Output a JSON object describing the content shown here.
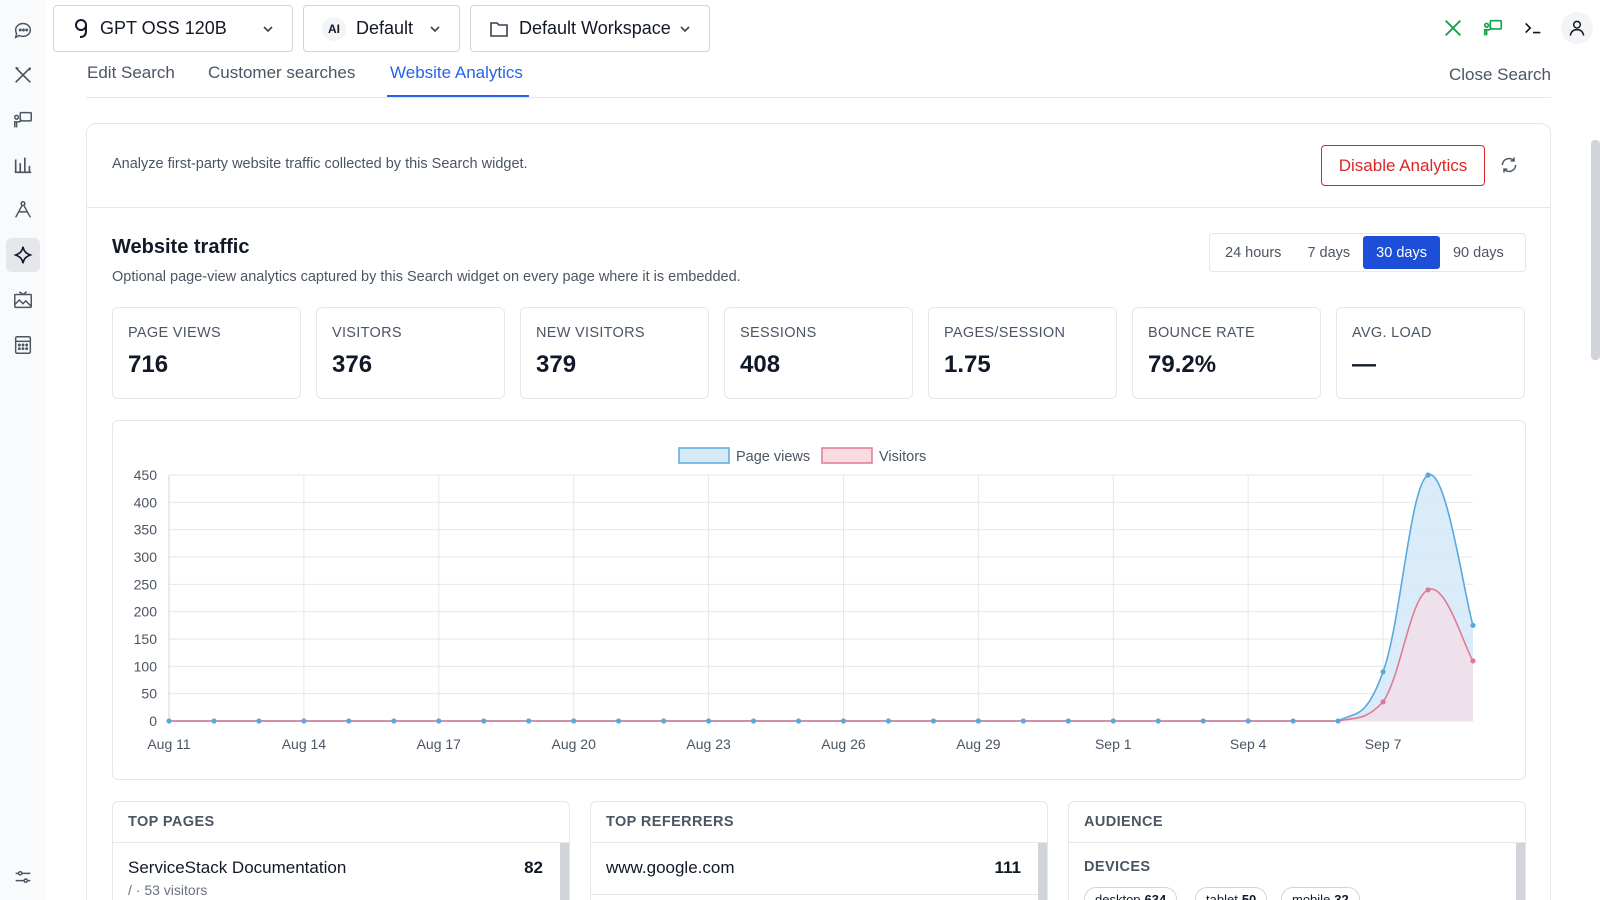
{
  "top_bar": {
    "model": {
      "icon": "qwen-logo-icon",
      "label": "GPT OSS 120B"
    },
    "persona": {
      "icon": "ai-icon",
      "icon_text": "AI",
      "label": "Default"
    },
    "workspace": {
      "icon": "folder-icon",
      "label": "Default Workspace"
    },
    "right_icons": [
      "tools-icon",
      "presenter-icon",
      "terminal-icon",
      "user-icon"
    ]
  },
  "sidebar": {
    "items": [
      "chat-icon",
      "tools-icon",
      "presenter-icon",
      "bar-chart-icon",
      "compass-icon",
      "sparkle-icon",
      "image-icon",
      "calculator-icon",
      "settings-sliders-icon"
    ],
    "active": "sparkle-icon"
  },
  "tabs": {
    "items": [
      {
        "label": "Edit Search"
      },
      {
        "label": "Customer searches"
      },
      {
        "label": "Website Analytics"
      }
    ],
    "active": "Website Analytics",
    "close_label": "Close Search"
  },
  "analytics": {
    "description": "Analyze first-party website traffic collected by this Search widget.",
    "disable_label": "Disable Analytics",
    "refresh_icon": "refresh-icon",
    "traffic_title": "Website traffic",
    "traffic_subtitle": "Optional page-view analytics captured by this Search widget on every page where it is embedded.",
    "ranges": [
      "24 hours",
      "7 days",
      "30 days",
      "90 days"
    ],
    "active_range": "30 days",
    "stats": [
      {
        "label": "PAGE VIEWS",
        "value": "716"
      },
      {
        "label": "VISITORS",
        "value": "376"
      },
      {
        "label": "NEW VISITORS",
        "value": "379"
      },
      {
        "label": "SESSIONS",
        "value": "408"
      },
      {
        "label": "PAGES/SESSION",
        "value": "1.75"
      },
      {
        "label": "BOUNCE RATE",
        "value": "79.2%"
      },
      {
        "label": "AVG. LOAD",
        "value": "—"
      }
    ]
  },
  "panels": {
    "top_pages": {
      "title": "TOP PAGES",
      "rows": [
        {
          "label": "ServiceStack Documentation",
          "sub": "/ · 53 visitors",
          "count": "82"
        }
      ]
    },
    "top_referrers": {
      "title": "TOP REFERRERS",
      "rows": [
        {
          "label": "www.google.com",
          "count": "111"
        }
      ]
    },
    "audience": {
      "title": "AUDIENCE",
      "devices_title": "DEVICES",
      "devices": [
        {
          "name": "desktop",
          "count": "634"
        },
        {
          "name": "tablet",
          "count": "50"
        },
        {
          "name": "mobile",
          "count": "32"
        }
      ]
    }
  },
  "colors": {
    "accent": "#2563eb",
    "danger": "#dc2626",
    "page_views_line": "#5aa9dc",
    "page_views_fill": "#d6eaf8",
    "visitors_line": "#e07a93",
    "visitors_fill": "#fbdbe2"
  },
  "chart_data": {
    "type": "area",
    "x": [
      "Aug 11",
      "Aug 12",
      "Aug 13",
      "Aug 14",
      "Aug 15",
      "Aug 16",
      "Aug 17",
      "Aug 18",
      "Aug 19",
      "Aug 20",
      "Aug 21",
      "Aug 22",
      "Aug 23",
      "Aug 24",
      "Aug 25",
      "Aug 26",
      "Aug 27",
      "Aug 28",
      "Aug 29",
      "Aug 30",
      "Aug 31",
      "Sep 1",
      "Sep 2",
      "Sep 3",
      "Sep 4",
      "Sep 5",
      "Sep 6",
      "Sep 7",
      "Sep 8",
      "Sep 9"
    ],
    "x_tick_labels": [
      "Aug 11",
      "Aug 14",
      "Aug 17",
      "Aug 20",
      "Aug 23",
      "Aug 26",
      "Aug 29",
      "Sep 1",
      "Sep 4",
      "Sep 7"
    ],
    "series": [
      {
        "name": "Page views",
        "values": [
          0,
          0,
          0,
          0,
          0,
          0,
          0,
          0,
          0,
          0,
          0,
          0,
          0,
          0,
          0,
          0,
          0,
          0,
          0,
          0,
          0,
          0,
          0,
          0,
          0,
          0,
          0,
          90,
          450,
          175
        ]
      },
      {
        "name": "Visitors",
        "values": [
          0,
          0,
          0,
          0,
          0,
          0,
          0,
          0,
          0,
          0,
          0,
          0,
          0,
          0,
          0,
          0,
          0,
          0,
          0,
          0,
          0,
          0,
          0,
          0,
          0,
          0,
          0,
          35,
          240,
          110
        ]
      }
    ],
    "ylim": [
      0,
      450
    ],
    "y_ticks": [
      0,
      50,
      100,
      150,
      200,
      250,
      300,
      350,
      400,
      450
    ],
    "grid": true,
    "legend": "top-center"
  }
}
